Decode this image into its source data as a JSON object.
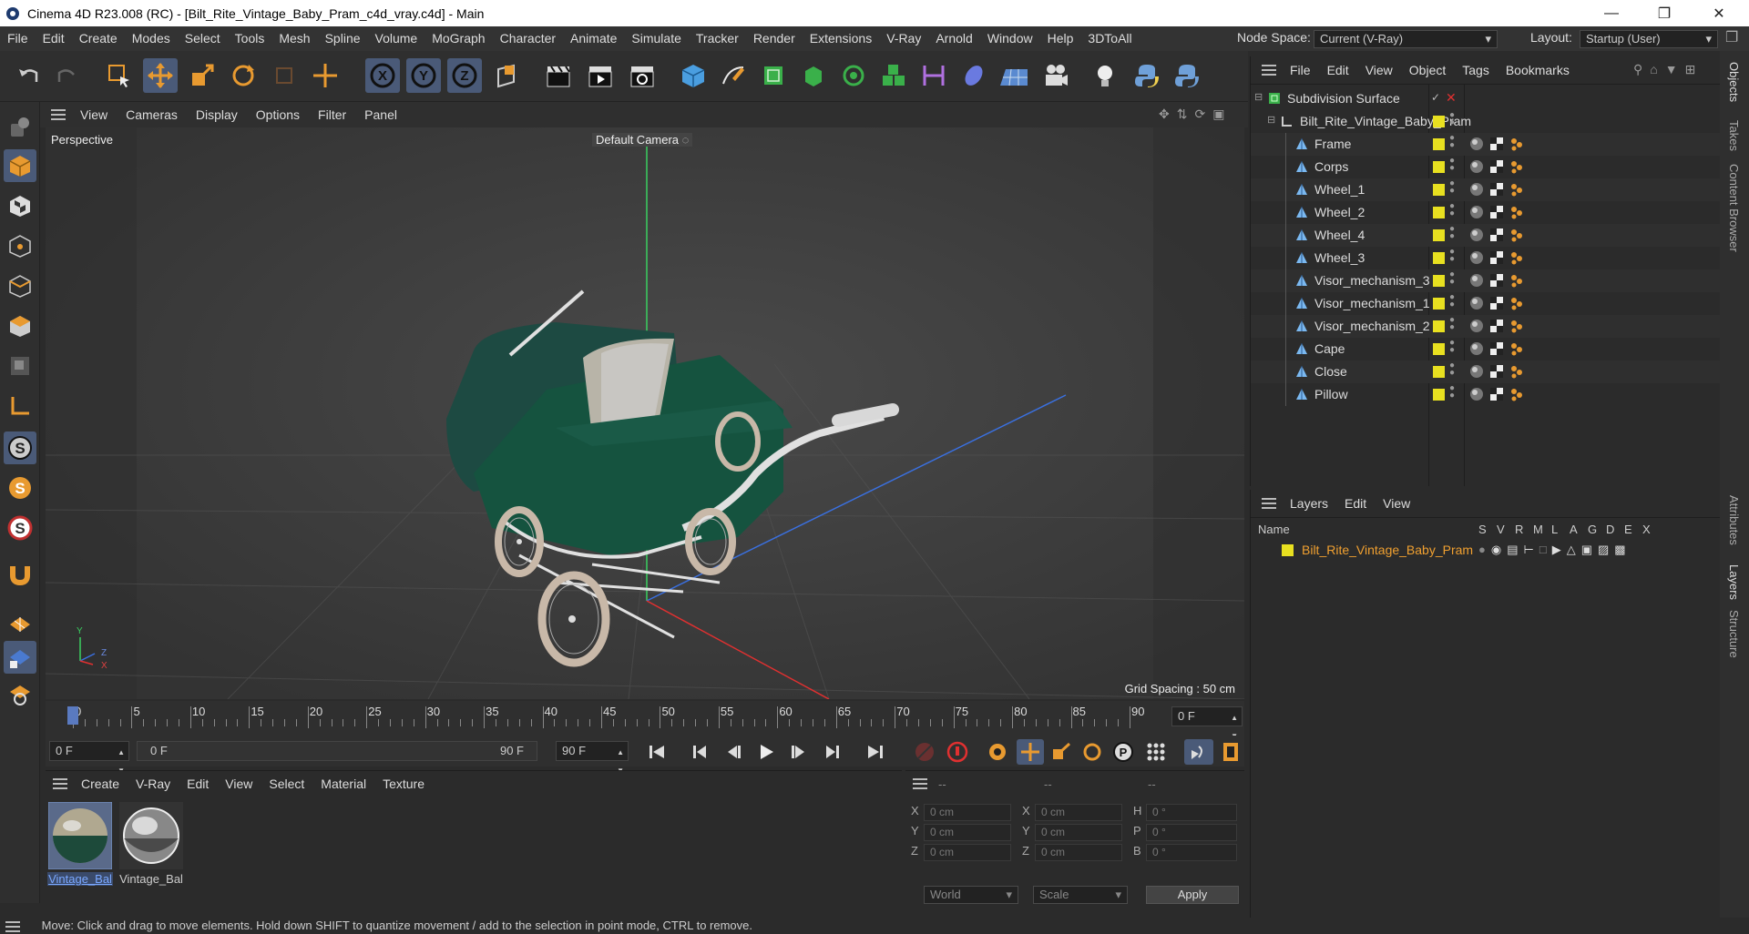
{
  "titlebar": {
    "title": "Cinema 4D R23.008 (RC) - [Bilt_Rite_Vintage_Baby_Pram_c4d_vray.c4d] - Main",
    "minimize_icon": "minimize-icon",
    "restore_icon": "restore-icon",
    "close_icon": "close-icon"
  },
  "menubar": {
    "items": [
      "File",
      "Edit",
      "Create",
      "Modes",
      "Select",
      "Tools",
      "Mesh",
      "Spline",
      "Volume",
      "MoGraph",
      "Character",
      "Animate",
      "Simulate",
      "Tracker",
      "Render",
      "Extensions",
      "V-Ray",
      "Arnold",
      "Window",
      "Help",
      "3DToAll"
    ],
    "node_space_label": "Node Space:",
    "node_space_value": "Current (V-Ray)",
    "layout_label": "Layout:",
    "layout_value": "Startup (User)"
  },
  "viewport": {
    "menu": [
      "View",
      "Cameras",
      "Display",
      "Options",
      "Filter",
      "Panel"
    ],
    "view_name": "Perspective",
    "camera_name": "Default Camera",
    "grid_spacing": "Grid Spacing : 50 cm",
    "axis_labels": {
      "y": "Y",
      "z": "Z",
      "x": "X"
    }
  },
  "timeline": {
    "ticks": [
      "0",
      "5",
      "10",
      "15",
      "20",
      "25",
      "30",
      "35",
      "40",
      "45",
      "50",
      "55",
      "60",
      "65",
      "70",
      "75",
      "80",
      "85",
      "90"
    ],
    "current_frame_field": "0 F",
    "start_field": "0 F",
    "range_start": "0 F",
    "range_end": "90 F",
    "end_field": "90 F"
  },
  "materials": {
    "menu": [
      "Create",
      "V-Ray",
      "Edit",
      "View",
      "Select",
      "Material",
      "Texture"
    ],
    "items": [
      {
        "label": "Vintage_Bal",
        "selected": true
      },
      {
        "label": "Vintage_Bal",
        "selected": false
      }
    ]
  },
  "attributes": {
    "header_dashes": [
      "--",
      "--",
      "--"
    ],
    "rows": [
      {
        "a": "X",
        "av": "0 cm",
        "b": "X",
        "bv": "0 cm",
        "c": "H",
        "cv": "0 °"
      },
      {
        "a": "Y",
        "av": "0 cm",
        "b": "Y",
        "bv": "0 cm",
        "c": "P",
        "cv": "0 °"
      },
      {
        "a": "Z",
        "av": "0 cm",
        "b": "Z",
        "bv": "0 cm",
        "c": "B",
        "cv": "0 °"
      }
    ],
    "coord_dropdown": "World",
    "size_dropdown": "Scale",
    "apply_label": "Apply"
  },
  "objects": {
    "menu": [
      "File",
      "Edit",
      "View",
      "Object",
      "Tags",
      "Bookmarks"
    ],
    "root": "Subdivision Surface",
    "group": "Bilt_Rite_Vintage_Baby_Pram",
    "children": [
      "Frame",
      "Corps",
      "Wheel_1",
      "Wheel_2",
      "Wheel_4",
      "Wheel_3",
      "Visor_mechanism_3",
      "Visor_mechanism_1",
      "Visor_mechanism_2",
      "Cape",
      "Close",
      "Pillow"
    ]
  },
  "layers": {
    "menu": [
      "Layers",
      "Edit",
      "View"
    ],
    "columns": [
      "Name",
      "S",
      "V",
      "R",
      "M",
      "L",
      "A",
      "G",
      "D",
      "E",
      "X"
    ],
    "rows": [
      {
        "name": "Bilt_Rite_Vintage_Baby_Pram"
      }
    ]
  },
  "right_tabs": [
    "Objects",
    "Takes",
    "Content Browser",
    "Attributes",
    "Layers",
    "Structure"
  ],
  "status": "Move: Click and drag to move elements. Hold down SHIFT to quantize movement / add to the selection in point mode, CTRL to remove.",
  "colors": {
    "accent": "#4a5a78",
    "layer_yellow": "#e8e020",
    "highlight_text": "#f0a030"
  }
}
